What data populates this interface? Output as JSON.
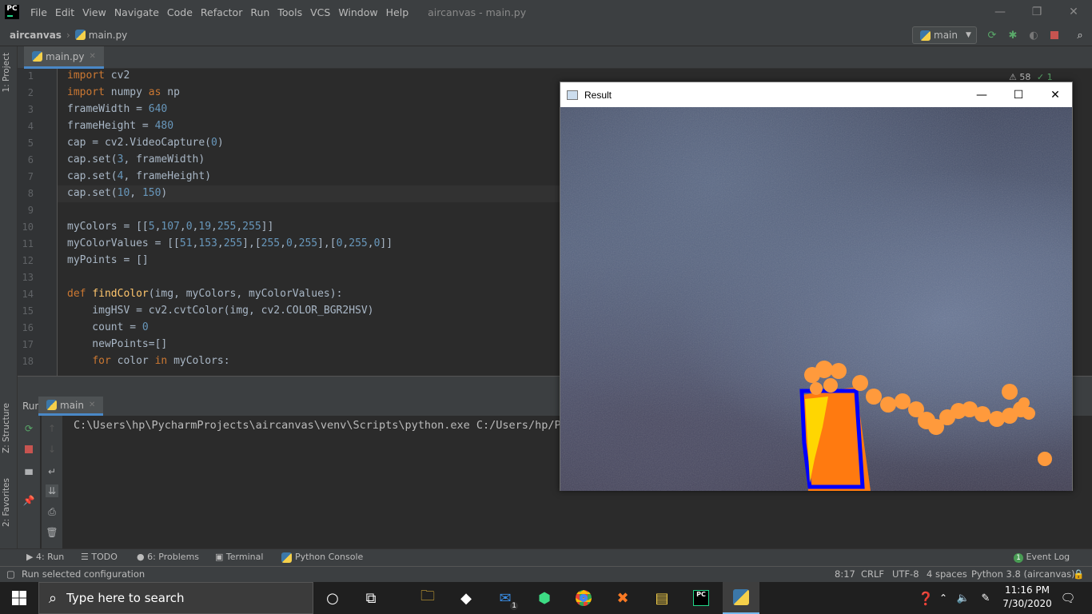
{
  "app": {
    "logo": "PC",
    "window_title": "aircanvas - main.py"
  },
  "menu": [
    "File",
    "Edit",
    "View",
    "Navigate",
    "Code",
    "Refactor",
    "Run",
    "Tools",
    "VCS",
    "Window",
    "Help"
  ],
  "window_controls": {
    "minimize": "—",
    "restore": "❐",
    "close": "✕"
  },
  "breadcrumb": {
    "project": "aircanvas",
    "separator": "›",
    "file": "main.py"
  },
  "run_config": {
    "label": "main",
    "arrow": "▼"
  },
  "left_strip": {
    "project": "1: Project",
    "structure": "Z: Structure",
    "favorites": "2: Favorites"
  },
  "editor_tab": {
    "label": "main.py",
    "close": "✕"
  },
  "inspections": {
    "warnings": "⚠ 58",
    "ok": "✓ 1"
  },
  "code": {
    "line_numbers": [
      "1",
      "2",
      "3",
      "4",
      "5",
      "6",
      "7",
      "8",
      "9",
      "10",
      "11",
      "12",
      "13",
      "14",
      "15",
      "16",
      "17",
      "18"
    ],
    "lines": [
      {
        "segments": [
          [
            "kw",
            "import"
          ],
          [
            "t",
            " cv2"
          ]
        ]
      },
      {
        "segments": [
          [
            "kw",
            "import"
          ],
          [
            "t",
            " numpy "
          ],
          [
            "kw",
            "as"
          ],
          [
            "t",
            " np"
          ]
        ]
      },
      {
        "segments": [
          [
            "t",
            "frameWidth = "
          ],
          [
            "num",
            "640"
          ]
        ]
      },
      {
        "segments": [
          [
            "t",
            "frameHeight = "
          ],
          [
            "num",
            "480"
          ]
        ]
      },
      {
        "segments": [
          [
            "t",
            "cap = cv2.VideoCapture("
          ],
          [
            "num",
            "0"
          ],
          [
            "t",
            ")"
          ]
        ]
      },
      {
        "segments": [
          [
            "t",
            "cap.set("
          ],
          [
            "num",
            "3"
          ],
          [
            "t",
            ", frameWidth)"
          ]
        ]
      },
      {
        "segments": [
          [
            "t",
            "cap.set("
          ],
          [
            "num",
            "4"
          ],
          [
            "t",
            ", frameHeight)"
          ]
        ]
      },
      {
        "segments": [
          [
            "t",
            "cap.set("
          ],
          [
            "num",
            "10"
          ],
          [
            "t",
            ", "
          ],
          [
            "num",
            "150"
          ],
          [
            "t",
            ")"
          ]
        ]
      },
      {
        "segments": [
          [
            "t",
            ""
          ]
        ]
      },
      {
        "segments": [
          [
            "t",
            "myColors = [["
          ],
          [
            "num",
            "5"
          ],
          [
            "t",
            ","
          ],
          [
            "num",
            "107"
          ],
          [
            "t",
            ","
          ],
          [
            "num",
            "0"
          ],
          [
            "t",
            ","
          ],
          [
            "num",
            "19"
          ],
          [
            "t",
            ","
          ],
          [
            "num",
            "255"
          ],
          [
            "t",
            ","
          ],
          [
            "num",
            "255"
          ],
          [
            "t",
            "]]"
          ]
        ]
      },
      {
        "segments": [
          [
            "t",
            "myColorValues = [["
          ],
          [
            "num",
            "51"
          ],
          [
            "t",
            ","
          ],
          [
            "num",
            "153"
          ],
          [
            "t",
            ","
          ],
          [
            "num",
            "255"
          ],
          [
            "t",
            "],["
          ],
          [
            "num",
            "255"
          ],
          [
            "t",
            ","
          ],
          [
            "num",
            "0"
          ],
          [
            "t",
            ","
          ],
          [
            "num",
            "255"
          ],
          [
            "t",
            "],["
          ],
          [
            "num",
            "0"
          ],
          [
            "t",
            ","
          ],
          [
            "num",
            "255"
          ],
          [
            "t",
            ","
          ],
          [
            "num",
            "0"
          ],
          [
            "t",
            "]]"
          ]
        ]
      },
      {
        "segments": [
          [
            "t",
            "myPoints = []"
          ]
        ]
      },
      {
        "segments": [
          [
            "t",
            ""
          ]
        ]
      },
      {
        "segments": [
          [
            "kw",
            "def"
          ],
          [
            "t",
            " "
          ],
          [
            "fn",
            "findColor"
          ],
          [
            "t",
            "(img, myColors, myColorValues):"
          ]
        ]
      },
      {
        "segments": [
          [
            "t",
            "    imgHSV = cv2.cvtColor(img, cv2.COLOR_BGR2HSV)"
          ]
        ]
      },
      {
        "segments": [
          [
            "t",
            "    count = "
          ],
          [
            "num",
            "0"
          ]
        ]
      },
      {
        "segments": [
          [
            "t",
            "    newPoints=[]"
          ]
        ]
      },
      {
        "segments": [
          [
            "t",
            "    "
          ],
          [
            "kw",
            "for"
          ],
          [
            "t",
            " color "
          ],
          [
            "kw",
            "in"
          ],
          [
            "t",
            " myColors:"
          ]
        ]
      }
    ]
  },
  "run_panel": {
    "label": "Run:",
    "tab": "main",
    "close": "✕"
  },
  "console": {
    "line": "C:\\Users\\hp\\PycharmProjects\\aircanvas\\venv\\Scripts\\python.exe C:/Users/hp/Py"
  },
  "bottom_tools": {
    "run": "4: Run",
    "todo": "TODO",
    "problems": "6: Problems",
    "terminal": "Terminal",
    "python_console": "Python Console",
    "event_log": "Event Log",
    "event_count": "1"
  },
  "status": {
    "message": "Run selected configuration",
    "position": "8:17",
    "line_sep": "CRLF",
    "encoding": "UTF-8",
    "indent": "4 spaces",
    "interpreter": "Python 3.8 (aircanvas)"
  },
  "result_window": {
    "title": "Result"
  },
  "taskbar": {
    "search_placeholder": "Type here to search",
    "time": "11:16 PM",
    "date": "7/30/2020",
    "mail_badge": "1"
  },
  "colors": {
    "accent": "#4a88c7",
    "keyword": "#cc7832",
    "number": "#6897bb",
    "function": "#ffc66d",
    "text": "#a9b7c6"
  }
}
